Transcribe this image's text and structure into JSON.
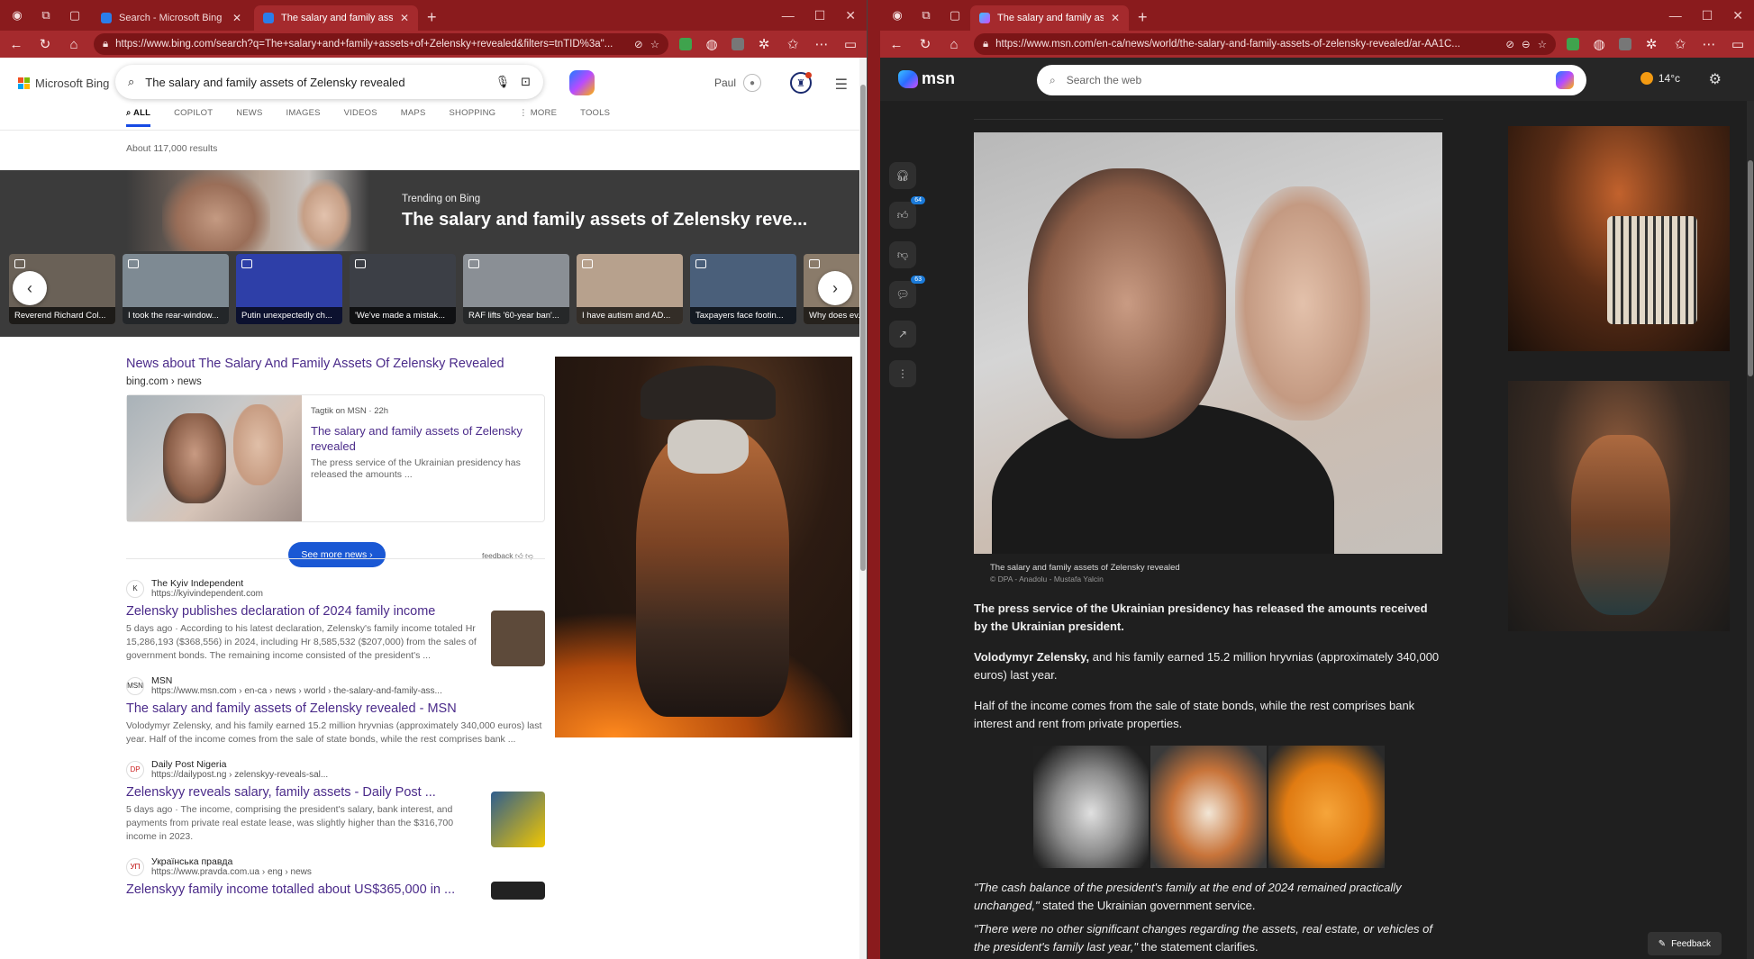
{
  "left": {
    "tabs": [
      {
        "title": "Search - Microsoft Bing",
        "active": false
      },
      {
        "title": "The salary and family assets of Ze",
        "active": true
      }
    ],
    "url": "https://www.bing.com/search?q=The+salary+and+family+assets+of+Zelensky+revealed&filters=tnTID%3a\"...",
    "bing": {
      "logo": "Microsoft Bing",
      "query": "The salary and family assets of Zelensky revealed",
      "user": "Paul",
      "nav": [
        "ALL",
        "COPILOT",
        "NEWS",
        "IMAGES",
        "VIDEOS",
        "MAPS",
        "SHOPPING",
        "⋮ MORE",
        "TOOLS"
      ],
      "result_count": "About 117,000 results",
      "trending_label": "Trending on Bing",
      "trending_title": "The salary and family assets of Zelensky reve...",
      "tiles": [
        {
          "caption": "Reverend Richard Col...",
          "color": "#6a6157"
        },
        {
          "caption": "I took the rear-window...",
          "color": "#7e8a93"
        },
        {
          "caption": "Putin unexpectedly ch...",
          "color": "#2e3fa8"
        },
        {
          "caption": "'We've made a mistak...",
          "color": "#3c3f46"
        },
        {
          "caption": "RAF lifts '60-year ban'...",
          "color": "#8a8f95"
        },
        {
          "caption": "I have autism and AD...",
          "color": "#b7a18d"
        },
        {
          "caption": "Taxpayers face footin...",
          "color": "#4a5f7a"
        },
        {
          "caption": "Why does ev...",
          "color": "#8a7b6a"
        }
      ],
      "news_heading": "News about The Salary And Family Assets Of Zelensky Revealed",
      "news_source": "bing.com › news",
      "card": {
        "meta": "Tagtik on MSN · 22h",
        "title": "The salary and family assets of Zelensky revealed",
        "snippet": "The press service of the Ukrainian presidency has released the amounts ..."
      },
      "see_more": "See more news ›",
      "feedback": "feedback",
      "results": [
        {
          "icon": "K",
          "name": "The Kyiv Independent",
          "url": "https://kyivindependent.com",
          "title": "Zelensky publishes declaration of 2024 family income",
          "snippet": "5 days ago · According to his latest declaration, Zelensky's family income totaled Hr 15,286,193 ($368,556) in 2024, including Hr 8,585,532 ($207,000) from the sales of government bonds. The remaining income consisted of the president's ...",
          "thumb": "#5d4a3a"
        },
        {
          "icon": "MSN",
          "name": "MSN",
          "url": "https://www.msn.com › en-ca › news › world › the-salary-and-family-ass...",
          "title": "The salary and family assets of Zelensky revealed - MSN",
          "snippet": "Volodymyr Zelensky, and his family earned 15.2 million hryvnias (approximately 340,000 euros) last year. Half of the income comes from the sale of state bonds, while the rest comprises bank ...",
          "thumb": ""
        },
        {
          "icon": "DP",
          "name": "Daily Post Nigeria",
          "url": "https://dailypost.ng › zelenskyy-reveals-sal...",
          "title": "Zelenskyy reveals salary, family assets - Daily Post ...",
          "snippet": "5 days ago · The income, comprising the president's salary, bank interest, and payments from private real estate lease, was slightly higher than the $316,700 income in 2023.",
          "thumb": "#2f5e8e"
        },
        {
          "icon": "УП",
          "name": "Українська правда",
          "url": "https://www.pravda.com.ua › eng › news",
          "title": "Zelenskyy family income totalled about US$365,000 in ...",
          "snippet": "",
          "thumb": "#222"
        }
      ]
    }
  },
  "right": {
    "tab": {
      "title": "The salary and family assets of Ze"
    },
    "url": "https://www.msn.com/en-ca/news/world/the-salary-and-family-assets-of-zelensky-revealed/ar-AA1C...",
    "msn": {
      "logo": "msn",
      "search_placeholder": "Search the web",
      "temperature": "14°c",
      "rail_badges": {
        "likes": "64",
        "comments": "63"
      },
      "caption": "The salary and family assets of Zelensky revealed",
      "credit": "© DPA - Anadolu - Mustafa Yalcin",
      "lead": "The press service of the Ukrainian presidency has released the amounts received by the Ukrainian president.",
      "p1_bold": "Volodymyr Zelensky,",
      "p1_rest": " and his family earned 15.2 million hryvnias (approximately 340,000 euros) last year.",
      "p2": "Half of the income comes from the sale of state bonds, while the rest comprises bank interest and rent from private properties.",
      "q1_italic": "\"The cash balance of the president's family at the end of 2024 remained practically unchanged,\"",
      "q1_rest": " stated the Ukrainian government service.",
      "q2_italic": "\"There were no other significant changes regarding the assets, real estate, or vehicles of the president's family last year,\"",
      "q2_rest": " the statement clarifies.",
      "feedback": "Feedback"
    }
  }
}
